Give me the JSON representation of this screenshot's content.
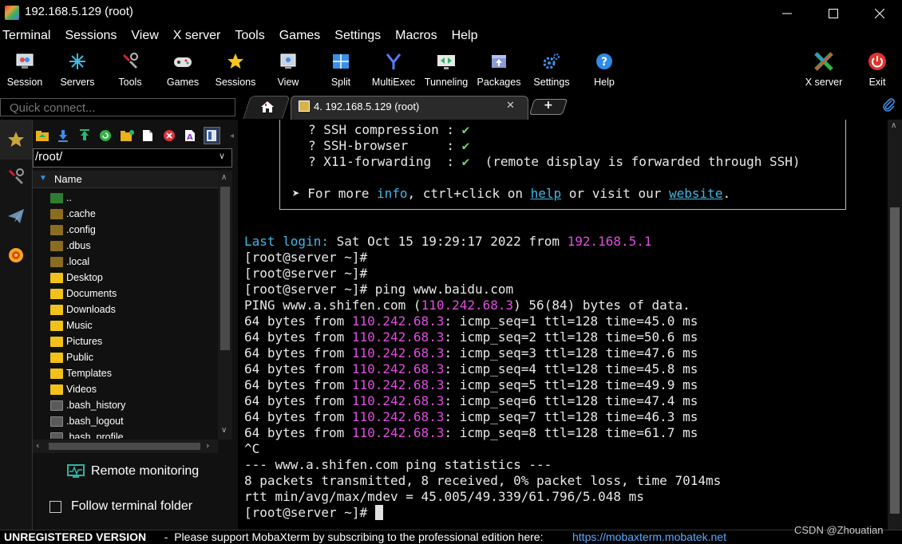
{
  "window": {
    "title": "192.168.5.129 (root)",
    "controls": {
      "minimize": "—",
      "maximize": "☐",
      "close": "✕"
    }
  },
  "menu": [
    "Terminal",
    "Sessions",
    "View",
    "X server",
    "Tools",
    "Games",
    "Settings",
    "Macros",
    "Help"
  ],
  "toolbar": [
    {
      "label": "Session",
      "icon": "session-icon"
    },
    {
      "label": "Servers",
      "icon": "servers-icon"
    },
    {
      "label": "Tools",
      "icon": "tools-icon"
    },
    {
      "label": "Games",
      "icon": "games-icon"
    },
    {
      "label": "Sessions",
      "icon": "star-icon"
    },
    {
      "label": "View",
      "icon": "view-icon"
    },
    {
      "label": "Split",
      "icon": "split-icon"
    },
    {
      "label": "MultiExec",
      "icon": "multiexec-icon"
    },
    {
      "label": "Tunneling",
      "icon": "tunneling-icon"
    },
    {
      "label": "Packages",
      "icon": "packages-icon"
    },
    {
      "label": "Settings",
      "icon": "gear-icon"
    },
    {
      "label": "Help",
      "icon": "help-icon"
    }
  ],
  "toolbar_right": [
    {
      "label": "X server",
      "icon": "xserver-icon"
    },
    {
      "label": "Exit",
      "icon": "power-icon"
    }
  ],
  "quick_connect": {
    "placeholder": "Quick connect..."
  },
  "tabs": {
    "active_label": "4. 192.168.5.129 (root)",
    "close": "✕",
    "new_tab": "+"
  },
  "sftp": {
    "path": "/root/",
    "column_header": "Name",
    "files": [
      {
        "name": "..",
        "type": "up"
      },
      {
        "name": ".cache",
        "type": "folder-dark"
      },
      {
        "name": ".config",
        "type": "folder-dark"
      },
      {
        "name": ".dbus",
        "type": "folder-dark"
      },
      {
        "name": ".local",
        "type": "folder-dark"
      },
      {
        "name": "Desktop",
        "type": "folder"
      },
      {
        "name": "Documents",
        "type": "folder"
      },
      {
        "name": "Downloads",
        "type": "folder"
      },
      {
        "name": "Music",
        "type": "folder"
      },
      {
        "name": "Pictures",
        "type": "folder"
      },
      {
        "name": "Public",
        "type": "folder"
      },
      {
        "name": "Templates",
        "type": "folder"
      },
      {
        "name": "Videos",
        "type": "folder"
      },
      {
        "name": ".bash_history",
        "type": "file"
      },
      {
        "name": ".bash_logout",
        "type": "file"
      },
      {
        "name": ".bash_profile",
        "type": "file"
      }
    ],
    "remote_monitoring": "Remote monitoring",
    "follow_terminal": "Follow terminal folder"
  },
  "terminal": {
    "banner": {
      "rows": [
        {
          "prefix": "? ",
          "name": "SSH compression",
          "pad": " : ",
          "mark": "✔",
          "note": ""
        },
        {
          "prefix": "? ",
          "name": "SSH-browser    ",
          "pad": " : ",
          "mark": "✔",
          "note": ""
        },
        {
          "prefix": "? ",
          "name": "X11-forwarding ",
          "pad": " : ",
          "mark": "✔",
          "note": "  (remote display is forwarded through SSH)"
        }
      ],
      "more_prefix": "➤ For more ",
      "more_info": "info",
      "more_mid": ", ctrl+click on ",
      "more_help": "help",
      "more_mid2": " or visit our ",
      "more_site": "website",
      "more_end": "."
    },
    "last_login": {
      "label": "Last login:",
      "text": " Sat Oct 15 19:29:17 2022 from ",
      "ip": "192.168.5.1"
    },
    "prompt": "[root@server ~]#",
    "command": " ping www.baidu.com",
    "ping_header": {
      "pre": "PING www.a.shifen.com (",
      "ip": "110.242.68.3",
      "post": ") 56(84) bytes of data."
    },
    "ping_lines": [
      {
        "pre": "64 bytes from ",
        "ip": "110.242.68.3",
        "post": ": icmp_seq=1 ttl=128 time=45.0 ms"
      },
      {
        "pre": "64 bytes from ",
        "ip": "110.242.68.3",
        "post": ": icmp_seq=2 ttl=128 time=50.6 ms"
      },
      {
        "pre": "64 bytes from ",
        "ip": "110.242.68.3",
        "post": ": icmp_seq=3 ttl=128 time=47.6 ms"
      },
      {
        "pre": "64 bytes from ",
        "ip": "110.242.68.3",
        "post": ": icmp_seq=4 ttl=128 time=45.8 ms"
      },
      {
        "pre": "64 bytes from ",
        "ip": "110.242.68.3",
        "post": ": icmp_seq=5 ttl=128 time=49.9 ms"
      },
      {
        "pre": "64 bytes from ",
        "ip": "110.242.68.3",
        "post": ": icmp_seq=6 ttl=128 time=47.4 ms"
      },
      {
        "pre": "64 bytes from ",
        "ip": "110.242.68.3",
        "post": ": icmp_seq=7 ttl=128 time=46.3 ms"
      },
      {
        "pre": "64 bytes from ",
        "ip": "110.242.68.3",
        "post": ": icmp_seq=8 ttl=128 time=61.7 ms"
      }
    ],
    "interrupt": "^C",
    "stats_title": "--- www.a.shifen.com ping statistics ---",
    "stats_packets": "8 packets transmitted, 8 received, 0% packet loss, time 7014ms",
    "stats_rtt": "rtt min/avg/max/mdev = 45.005/49.339/61.796/5.048 ms"
  },
  "status": {
    "unregistered": "UNREGISTERED VERSION",
    "message": "  -  Please support MobaXterm by subscribing to the professional edition here:  ",
    "link": "https://mobaxterm.mobatek.net"
  },
  "watermark": "CSDN @Zhouatian"
}
